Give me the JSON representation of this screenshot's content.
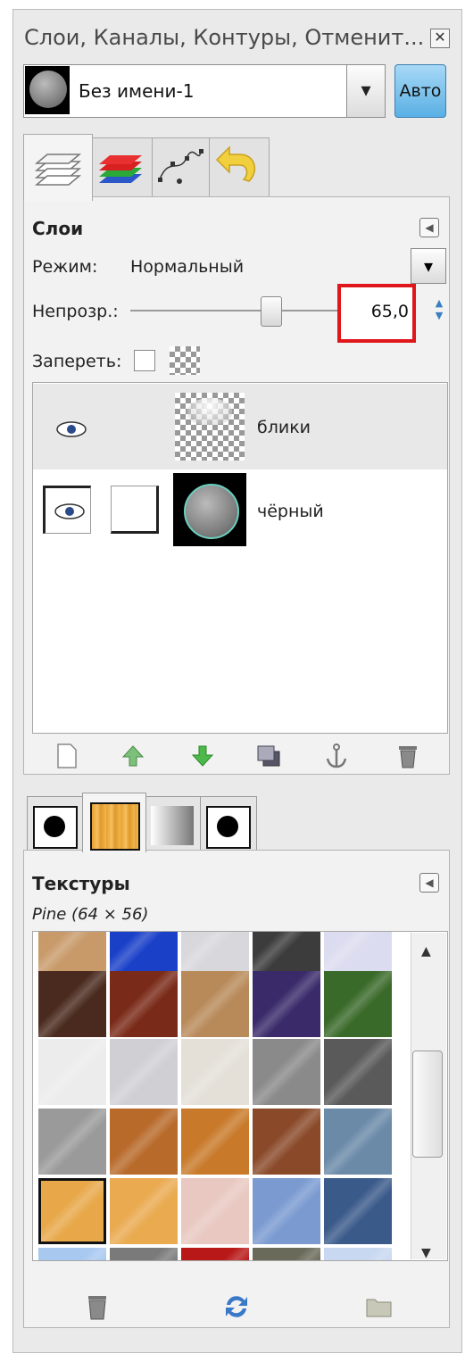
{
  "window": {
    "title": "Слои, Каналы, Контуры, Отменит...",
    "close_icon": "close-icon"
  },
  "image_selector": {
    "name": "Без имени-1",
    "auto_label": "Авто"
  },
  "dock_tabs": [
    {
      "name": "layers-tab",
      "icon": "layers-icon",
      "active": true
    },
    {
      "name": "channels-tab",
      "icon": "channels-icon",
      "active": false
    },
    {
      "name": "paths-tab",
      "icon": "paths-icon",
      "active": false
    },
    {
      "name": "undo-history-tab",
      "icon": "undo-icon",
      "active": false
    }
  ],
  "layers_panel": {
    "heading": "Слои",
    "mode_label": "Режим:",
    "mode_value": "Нормальный",
    "opacity_label": "Непрозр.:",
    "opacity_value": "65,0",
    "opacity_percent": 65.0,
    "lock_label": "Запереть:",
    "layers": [
      {
        "name": "блики",
        "visible": true,
        "selected": true
      },
      {
        "name": "чёрный",
        "visible": true,
        "selected": false
      }
    ],
    "actions": [
      "new-layer",
      "raise-layer",
      "lower-layer",
      "duplicate-layer",
      "anchor-layer",
      "delete-layer"
    ]
  },
  "brush_tabs": [
    "brushes-tab",
    "patterns-tab",
    "gradients-tab",
    "fonts-tab"
  ],
  "patterns_panel": {
    "heading": "Текстуры",
    "selected_info": "Pine (64 × 56)",
    "swatch_colors": [
      [
        "#c89a6a",
        "#1a40c8",
        "#d8d8dc",
        "#3c3c3c",
        "#dcdcf0"
      ],
      [
        "#4a2a1e",
        "#7a2a18",
        "#b88a5a",
        "#3a2a6a",
        "#3a6a2a"
      ],
      [
        "#ececec",
        "#d0d0d4",
        "#e4e0d8",
        "#8a8a8a",
        "#5a5a5a"
      ],
      [
        "#9a9a9a",
        "#b86a2a",
        "#c87a2a",
        "#8a4a2a",
        "#6a8aa8"
      ],
      [
        "#e8a84a",
        "#eaaa50",
        "#e8c8c0",
        "#7a9ad0",
        "#3a5a8a"
      ],
      [
        "#a8c8f0",
        "#7a7a7a",
        "#b81818",
        "#6a6a5a",
        "#c8d8f0"
      ]
    ],
    "selected_swatch": "Pine",
    "actions": [
      "delete-pattern",
      "refresh-patterns",
      "open-pattern-folder"
    ]
  },
  "accent_color": "#e0161b"
}
